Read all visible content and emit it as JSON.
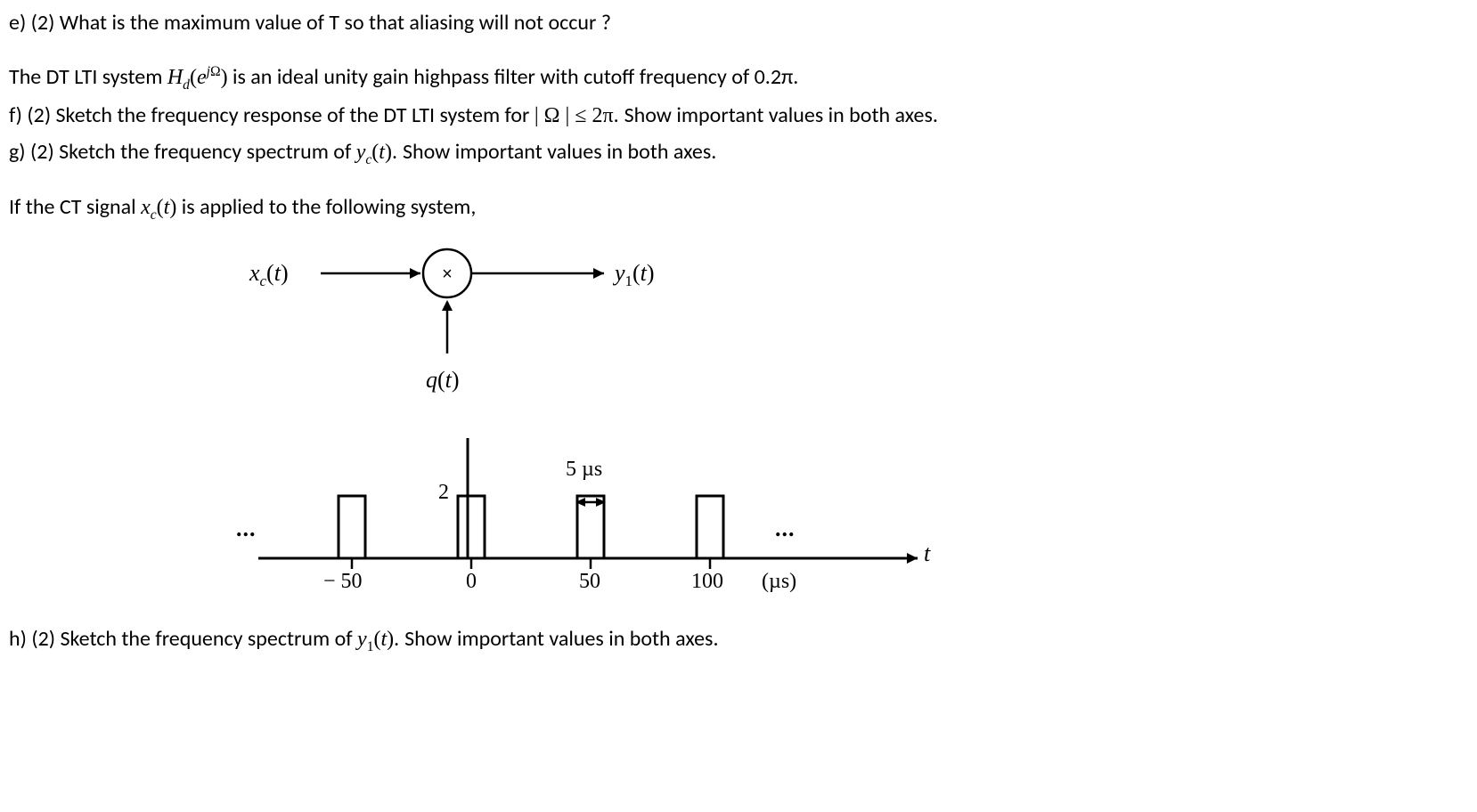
{
  "q_e": {
    "label": "e) (2) ",
    "text": "What is the maximum value of T so that aliasing will not occur ?"
  },
  "mid": {
    "pre": "The DT LTI system ",
    "H": "H",
    "Hsub": "d",
    "Hparen_l": "(",
    "e": "e",
    "j": "j",
    "Omega": "Ω",
    "Hparen_r": ")",
    "post": " is an ideal unity gain highpass filter with cutoff frequency of 0.2π."
  },
  "q_f": {
    "label": "f) (2) ",
    "text_pre": "Sketch the frequency response of the DT LTI system for ",
    "bar": "|",
    "Omega2": " Ω ",
    "bar2": "|",
    "le": " ≤ ",
    "val": "2π. ",
    "text_post": "Show important values in both axes."
  },
  "q_g": {
    "label": "g) (2) ",
    "text_pre": "Sketch the frequency spectrum of ",
    "y": "y",
    "ysub": "c",
    "yparen": "(",
    "t": "t",
    "yparen_r": "). ",
    "text_post": "Show important values in both axes."
  },
  "if_line": {
    "pre": "If the CT signal ",
    "x": "x",
    "xsub": "c",
    "xparen_l": "(",
    "t": "t",
    "xparen_r": ")",
    "post": " is applied to the following system,"
  },
  "diagram": {
    "xc_t": "x",
    "xc_sub": "c",
    "paren_l": "(",
    "t": "t",
    "paren_r": ")",
    "y1": "y",
    "y1_sub": "1",
    "mult": "×",
    "q": "q",
    "q_paren_l": "(",
    "q_t": "t",
    "q_paren_r": ")",
    "five_us_num": "5 ",
    "five_us_unit": "µs",
    "two": "2",
    "ellipsis1": "...",
    "ellipsis2": "...",
    "t_axis": "t",
    "m50": "− 50",
    "m0": "0",
    "m50p": "50",
    "m100": "100",
    "mus_l": "(",
    "mus_unit": "µs",
    "mus_r": ")"
  },
  "q_h": {
    "label": "h) (2) ",
    "text_pre": "Sketch the frequency spectrum of ",
    "y": "y",
    "ysub": "1",
    "yparen_l": "(",
    "t": "t",
    "yparen_r": "). ",
    "text_post": "Show important values in both axes."
  }
}
